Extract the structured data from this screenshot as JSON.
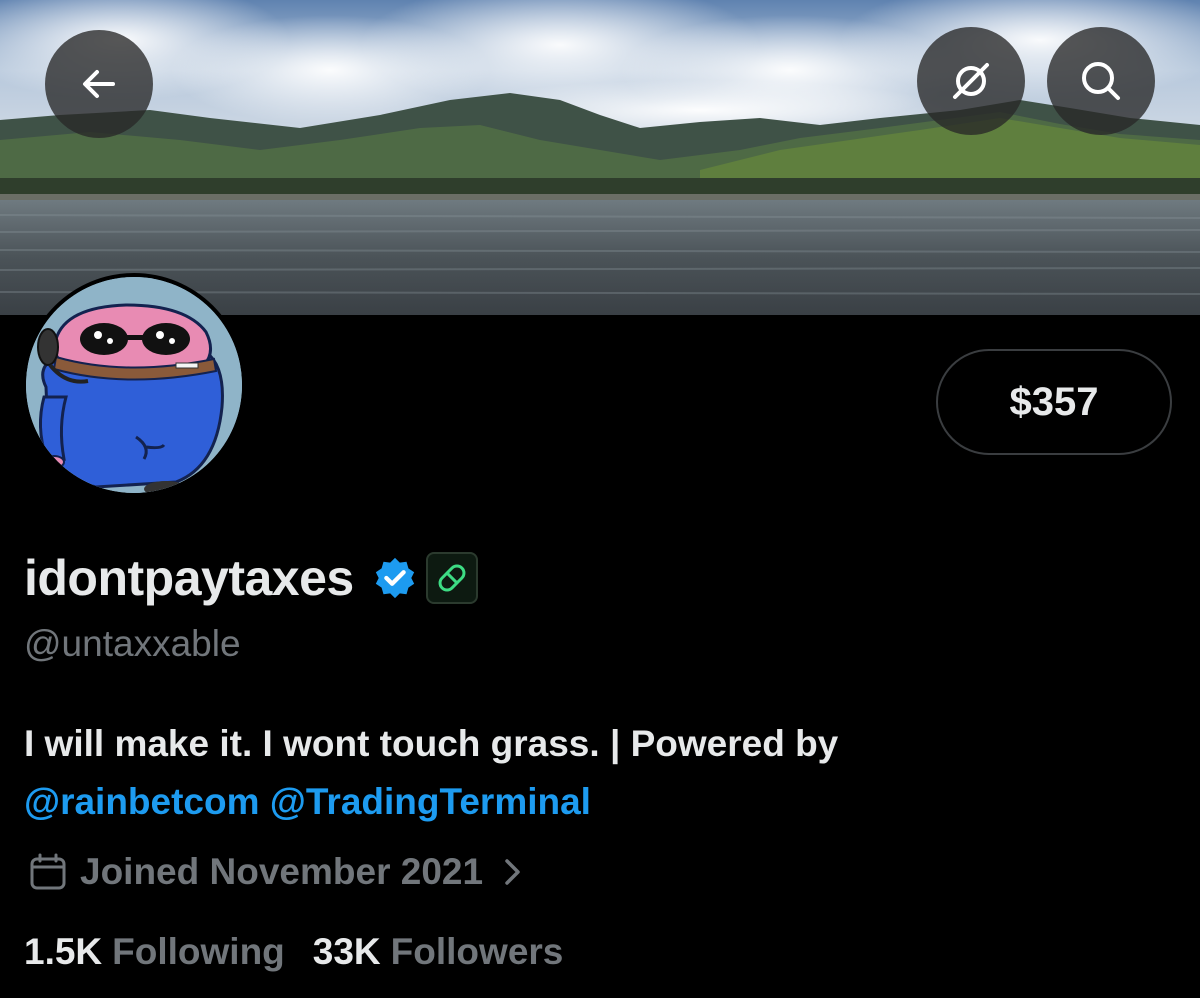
{
  "profile": {
    "display_name": "idontpaytaxes",
    "handle": "@untaxxable",
    "price_label": "$357",
    "bio": {
      "text": "I will make it. I wont touch grass. | Powered by",
      "mentions": [
        "@rainbetcom",
        "@TradingTerminal"
      ]
    },
    "joined": "Joined November 2021",
    "stats": {
      "following_count": "1.5K",
      "following_label": "Following",
      "followers_count": "33K",
      "followers_label": "Followers"
    }
  },
  "icons": {
    "back": "back-arrow-icon",
    "grok": "grok-icon",
    "search": "search-icon",
    "verified": "verified-badge-icon",
    "pill": "pill-icon",
    "calendar": "calendar-icon",
    "chevron": "chevron-right-icon"
  },
  "colors": {
    "background": "#000000",
    "text_primary": "#e7e9ea",
    "text_secondary": "#71767b",
    "link": "#1d9bf0",
    "verified": "#1d9bf0",
    "pill": "#3ddc84"
  }
}
